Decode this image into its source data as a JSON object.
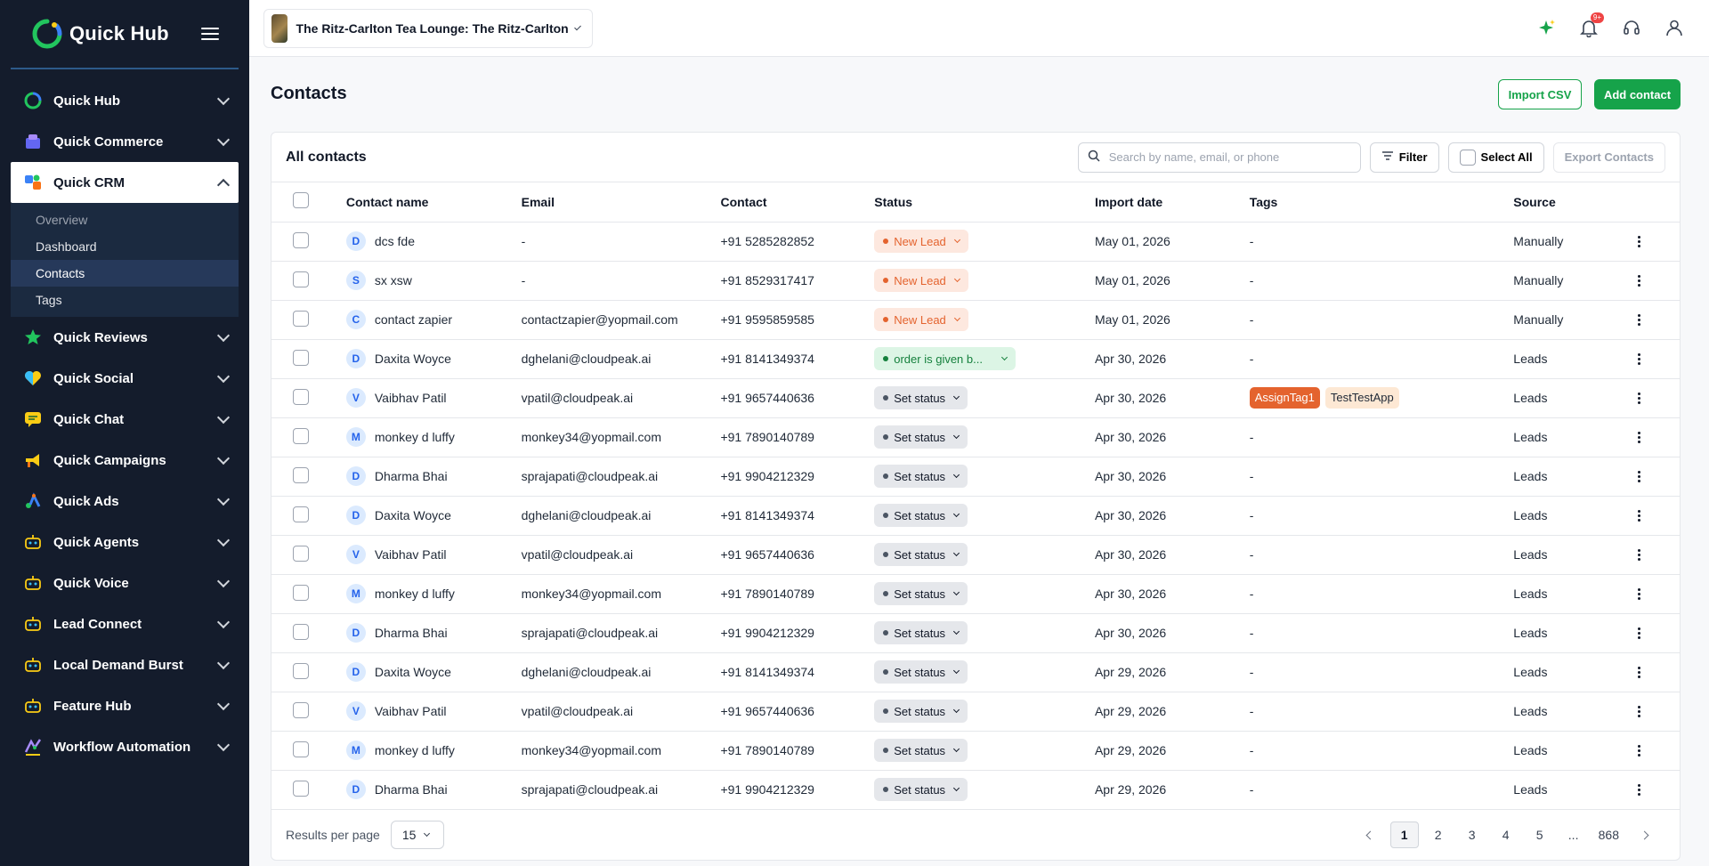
{
  "app": {
    "name": "Quick Hub",
    "business_name": "The Ritz-Carlton Tea Lounge: The Ritz-Carlton",
    "notification_count": "9+"
  },
  "sidebar": {
    "items": [
      {
        "label": "Quick Hub",
        "icon": "quick-hub-icon"
      },
      {
        "label": "Quick Commerce",
        "icon": "commerce-icon"
      },
      {
        "label": "Quick CRM",
        "icon": "crm-icon",
        "active": true
      },
      {
        "label": "Quick Reviews",
        "icon": "star-icon"
      },
      {
        "label": "Quick Social",
        "icon": "heart-icon"
      },
      {
        "label": "Quick Chat",
        "icon": "chat-icon"
      },
      {
        "label": "Quick Campaigns",
        "icon": "megaphone-icon"
      },
      {
        "label": "Quick Ads",
        "icon": "ads-icon"
      },
      {
        "label": "Quick Agents",
        "icon": "robot-icon"
      },
      {
        "label": "Quick Voice",
        "icon": "robot-icon"
      },
      {
        "label": "Lead Connect",
        "icon": "robot-icon"
      },
      {
        "label": "Local Demand Burst",
        "icon": "robot-icon"
      },
      {
        "label": "Feature Hub",
        "icon": "robot-icon"
      },
      {
        "label": "Workflow Automation",
        "icon": "workflow-icon"
      }
    ],
    "crm_subitems": [
      {
        "label": "Overview"
      },
      {
        "label": "Dashboard"
      },
      {
        "label": "Contacts",
        "active": true
      },
      {
        "label": "Tags"
      }
    ]
  },
  "page": {
    "title": "Contacts",
    "import_csv_label": "Import CSV",
    "add_contact_label": "Add contact"
  },
  "contacts_card": {
    "title": "All contacts",
    "search_placeholder": "Search by name, email, or phone",
    "filter_label": "Filter",
    "select_all_label": "Select All",
    "export_label": "Export Contacts",
    "columns": [
      "Contact name",
      "Email",
      "Contact",
      "Status",
      "Import date",
      "Tags",
      "Source"
    ],
    "rows": [
      {
        "initial": "D",
        "name": "dcs fde",
        "email": "-",
        "contact": "+91 5285282852",
        "status": "New Lead",
        "status_type": "newlead",
        "date": "May 01, 2026",
        "tags": [],
        "source": "Manually"
      },
      {
        "initial": "S",
        "name": "sx xsw",
        "email": "-",
        "contact": "+91 8529317417",
        "status": "New Lead",
        "status_type": "newlead",
        "date": "May 01, 2026",
        "tags": [],
        "source": "Manually"
      },
      {
        "initial": "C",
        "name": "contact zapier",
        "email": "contactzapier@yopmail.com",
        "contact": "+91 9595859585",
        "status": "New Lead",
        "status_type": "newlead",
        "date": "May 01, 2026",
        "tags": [],
        "source": "Manually"
      },
      {
        "initial": "D",
        "name": "Daxita Woyce",
        "email": "dghelani@cloudpeak.ai",
        "contact": "+91 8141349374",
        "status": "order is given b...",
        "status_type": "order",
        "date": "Apr 30, 2026",
        "tags": [],
        "source": "Leads"
      },
      {
        "initial": "V",
        "name": "Vaibhav Patil",
        "email": "vpatil@cloudpeak.ai",
        "contact": "+91 9657440636",
        "status": "Set status",
        "status_type": "setst",
        "date": "Apr 30, 2026",
        "tags": [
          "AssignTag1",
          "TestTestApp"
        ],
        "source": "Leads"
      },
      {
        "initial": "M",
        "name": "monkey d luffy",
        "email": "monkey34@yopmail.com",
        "contact": "+91 7890140789",
        "status": "Set status",
        "status_type": "setst",
        "date": "Apr 30, 2026",
        "tags": [],
        "source": "Leads"
      },
      {
        "initial": "D",
        "name": "Dharma Bhai",
        "email": "sprajapati@cloudpeak.ai",
        "contact": "+91 9904212329",
        "status": "Set status",
        "status_type": "setst",
        "date": "Apr 30, 2026",
        "tags": [],
        "source": "Leads"
      },
      {
        "initial": "D",
        "name": "Daxita Woyce",
        "email": "dghelani@cloudpeak.ai",
        "contact": "+91 8141349374",
        "status": "Set status",
        "status_type": "setst",
        "date": "Apr 30, 2026",
        "tags": [],
        "source": "Leads"
      },
      {
        "initial": "V",
        "name": "Vaibhav Patil",
        "email": "vpatil@cloudpeak.ai",
        "contact": "+91 9657440636",
        "status": "Set status",
        "status_type": "setst",
        "date": "Apr 30, 2026",
        "tags": [],
        "source": "Leads"
      },
      {
        "initial": "M",
        "name": "monkey d luffy",
        "email": "monkey34@yopmail.com",
        "contact": "+91 7890140789",
        "status": "Set status",
        "status_type": "setst",
        "date": "Apr 30, 2026",
        "tags": [],
        "source": "Leads"
      },
      {
        "initial": "D",
        "name": "Dharma Bhai",
        "email": "sprajapati@cloudpeak.ai",
        "contact": "+91 9904212329",
        "status": "Set status",
        "status_type": "setst",
        "date": "Apr 30, 2026",
        "tags": [],
        "source": "Leads"
      },
      {
        "initial": "D",
        "name": "Daxita Woyce",
        "email": "dghelani@cloudpeak.ai",
        "contact": "+91 8141349374",
        "status": "Set status",
        "status_type": "setst",
        "date": "Apr 29, 2026",
        "tags": [],
        "source": "Leads"
      },
      {
        "initial": "V",
        "name": "Vaibhav Patil",
        "email": "vpatil@cloudpeak.ai",
        "contact": "+91 9657440636",
        "status": "Set status",
        "status_type": "setst",
        "date": "Apr 29, 2026",
        "tags": [],
        "source": "Leads"
      },
      {
        "initial": "M",
        "name": "monkey d luffy",
        "email": "monkey34@yopmail.com",
        "contact": "+91 7890140789",
        "status": "Set status",
        "status_type": "setst",
        "date": "Apr 29, 2026",
        "tags": [],
        "source": "Leads"
      },
      {
        "initial": "D",
        "name": "Dharma Bhai",
        "email": "sprajapati@cloudpeak.ai",
        "contact": "+91 9904212329",
        "status": "Set status",
        "status_type": "setst",
        "date": "Apr 29, 2026",
        "tags": [],
        "source": "Leads"
      }
    ],
    "empty_value": "-"
  },
  "pagination": {
    "results_per_page_label": "Results per page",
    "results_per_page": "15",
    "pages": [
      "1",
      "2",
      "3",
      "4",
      "5",
      "...",
      "868"
    ],
    "current_page": "1"
  },
  "colors": {
    "sidebar_bg": "#141c2c",
    "primary_green": "#16a34a",
    "new_lead": "#e4632e",
    "tag_orange": "#e4632e"
  }
}
